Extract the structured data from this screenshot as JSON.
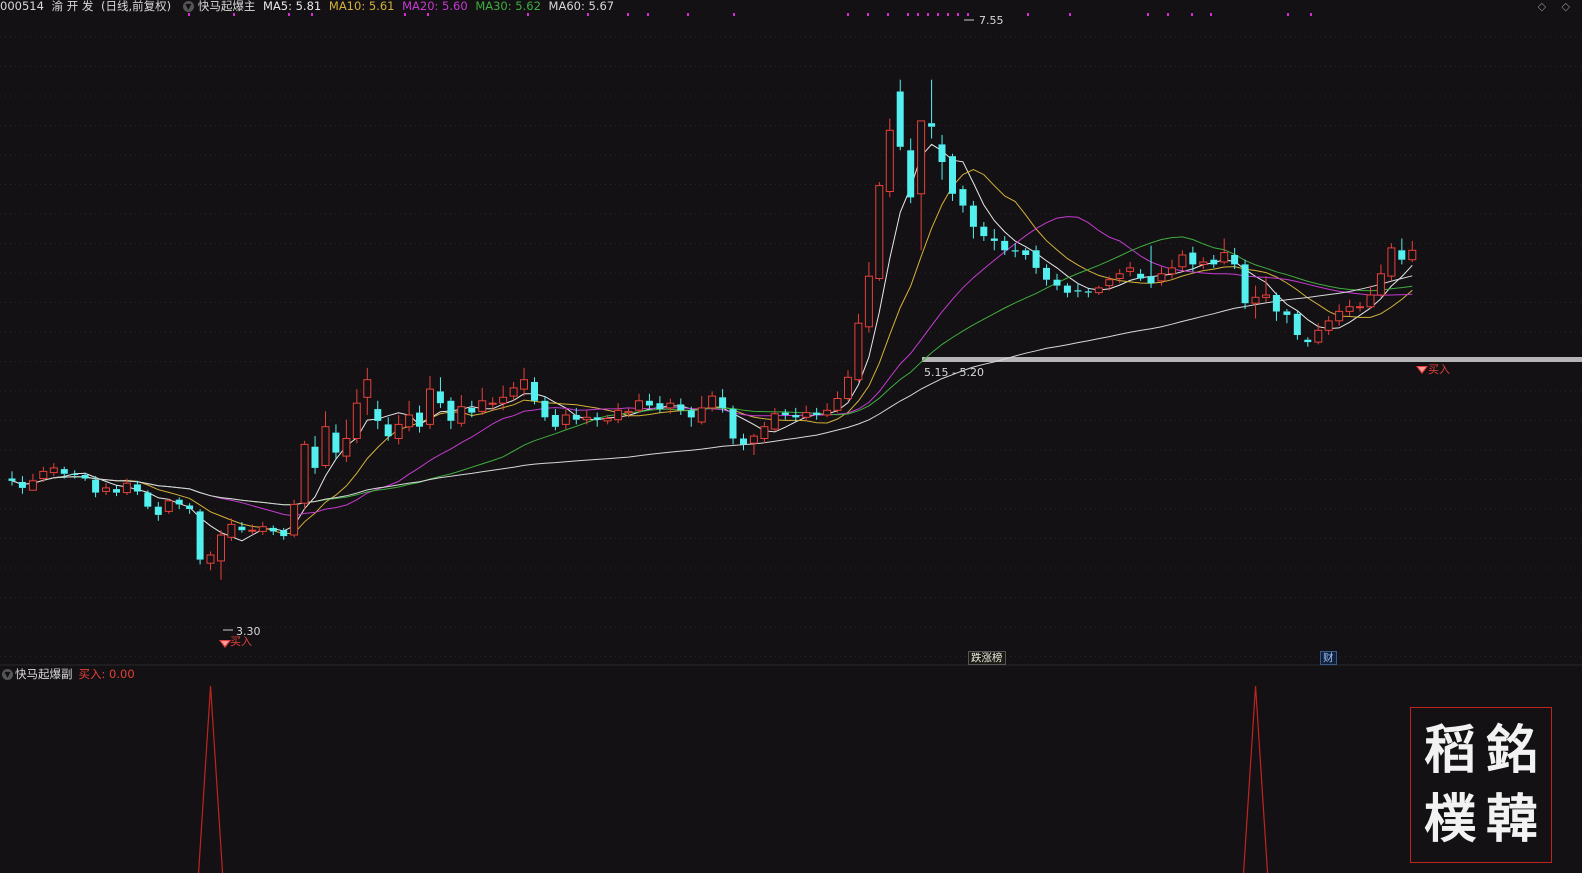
{
  "header": {
    "stock_code": "000514",
    "stock_name": "渝 开 发",
    "chart_mode": "(日线,前复权)",
    "indicator_name": "快马起爆主",
    "ma": [
      {
        "label": "MA5: 5.81",
        "color": "#e8e8e8"
      },
      {
        "label": "MA10: 5.61",
        "color": "#d4b23a"
      },
      {
        "label": "MA20: 5.60",
        "color": "#c63bd1"
      },
      {
        "label": "MA30: 5.62",
        "color": "#3fae3f"
      },
      {
        "label": "MA60: 5.67",
        "color": "#d8d8d8"
      }
    ]
  },
  "top_right": "◇ ◇",
  "annotations": {
    "high_label": "7.55",
    "low_label": "3.30",
    "range_label": "5.15 - 5.20",
    "buy_label": "买入",
    "tag_rank": "跌涨榜",
    "tag_fin": "财"
  },
  "sub": {
    "indicator_name": "快马起爆副",
    "buy_readout": "买入: 0.00"
  },
  "seal_chars": [
    "銘",
    "稻",
    "韓",
    "樸"
  ],
  "colors": {
    "up": "#e6403a",
    "down": "#54f0f0",
    "ma5": "#e8e8e8",
    "ma10": "#d4b23a",
    "ma20": "#c63bd1",
    "ma30": "#3fae3f",
    "ma60": "#d8d8d8",
    "support": "#b5b5b5",
    "signal": "#c0241f",
    "dots": "#d62bd6"
  },
  "chart_data": {
    "type": "candlestick",
    "price_axis": [
      2.6,
      8.1
    ],
    "high": 7.55,
    "low": 3.3,
    "support_zone": [
      5.15,
      5.2
    ],
    "buy_signals_at_candle": [
      19,
      119
    ],
    "candles": [
      [
        4.16,
        4.14,
        4.22,
        4.1
      ],
      [
        4.13,
        4.08,
        4.18,
        4.03
      ],
      [
        4.06,
        4.14,
        4.2,
        4.06
      ],
      [
        4.16,
        4.22,
        4.26,
        4.13
      ],
      [
        4.21,
        4.25,
        4.29,
        4.18
      ],
      [
        4.24,
        4.2,
        4.26,
        4.16
      ],
      [
        4.2,
        4.19,
        4.23,
        4.16
      ],
      [
        4.19,
        4.16,
        4.21,
        4.14
      ],
      [
        4.15,
        4.04,
        4.18,
        4.0
      ],
      [
        4.05,
        4.08,
        4.12,
        4.02
      ],
      [
        4.07,
        4.04,
        4.1,
        4.01
      ],
      [
        4.04,
        4.12,
        4.16,
        4.02
      ],
      [
        4.11,
        4.05,
        4.14,
        4.02
      ],
      [
        4.04,
        3.92,
        4.06,
        3.9
      ],
      [
        3.92,
        3.85,
        3.96,
        3.8
      ],
      [
        3.88,
        3.97,
        3.99,
        3.86
      ],
      [
        3.98,
        3.94,
        4.0,
        3.9
      ],
      [
        3.93,
        3.9,
        3.95,
        3.86
      ],
      [
        3.88,
        3.47,
        3.9,
        3.43
      ],
      [
        3.44,
        3.51,
        3.54,
        3.38
      ],
      [
        3.46,
        3.68,
        3.72,
        3.3
      ],
      [
        3.66,
        3.77,
        3.82,
        3.63
      ],
      [
        3.75,
        3.72,
        3.79,
        3.7
      ],
      [
        3.72,
        3.72,
        3.77,
        3.68
      ],
      [
        3.71,
        3.75,
        3.79,
        3.68
      ],
      [
        3.74,
        3.71,
        3.76,
        3.68
      ],
      [
        3.72,
        3.67,
        3.74,
        3.64
      ],
      [
        3.68,
        3.94,
        3.98,
        3.66
      ],
      [
        3.95,
        4.45,
        4.48,
        3.9
      ],
      [
        4.43,
        4.25,
        4.52,
        4.2
      ],
      [
        4.27,
        4.6,
        4.73,
        4.25
      ],
      [
        4.55,
        4.38,
        4.62,
        4.33
      ],
      [
        4.35,
        4.5,
        4.66,
        4.3
      ],
      [
        4.5,
        4.8,
        4.92,
        4.46
      ],
      [
        4.85,
        5.0,
        5.1,
        4.7
      ],
      [
        4.75,
        4.65,
        4.82,
        4.58
      ],
      [
        4.62,
        4.52,
        4.68,
        4.48
      ],
      [
        4.5,
        4.62,
        4.7,
        4.45
      ],
      [
        4.6,
        4.7,
        4.82,
        4.56
      ],
      [
        4.72,
        4.6,
        4.78,
        4.55
      ],
      [
        4.62,
        4.92,
        5.03,
        4.58
      ],
      [
        4.9,
        4.8,
        5.02,
        4.76
      ],
      [
        4.82,
        4.65,
        4.85,
        4.58
      ],
      [
        4.63,
        4.77,
        4.87,
        4.6
      ],
      [
        4.76,
        4.72,
        4.82,
        4.68
      ],
      [
        4.73,
        4.82,
        4.93,
        4.7
      ],
      [
        4.8,
        4.8,
        4.85,
        4.74
      ],
      [
        4.8,
        4.85,
        4.95,
        4.74
      ],
      [
        4.86,
        4.93,
        4.98,
        4.82
      ],
      [
        4.92,
        5.0,
        5.1,
        4.86
      ],
      [
        4.98,
        4.82,
        5.02,
        4.79
      ],
      [
        4.82,
        4.68,
        4.86,
        4.65
      ],
      [
        4.7,
        4.6,
        4.75,
        4.57
      ],
      [
        4.62,
        4.7,
        4.75,
        4.58
      ],
      [
        4.7,
        4.66,
        4.76,
        4.62
      ],
      [
        4.66,
        4.68,
        4.74,
        4.62
      ],
      [
        4.68,
        4.66,
        4.72,
        4.6
      ],
      [
        4.65,
        4.67,
        4.7,
        4.62
      ],
      [
        4.66,
        4.74,
        4.8,
        4.63
      ],
      [
        4.72,
        4.73,
        4.76,
        4.68
      ],
      [
        4.74,
        4.82,
        4.88,
        4.72
      ],
      [
        4.82,
        4.78,
        4.88,
        4.75
      ],
      [
        4.8,
        4.75,
        4.86,
        4.72
      ],
      [
        4.76,
        4.8,
        4.84,
        4.71
      ],
      [
        4.79,
        4.74,
        4.84,
        4.7
      ],
      [
        4.74,
        4.68,
        4.77,
        4.6
      ],
      [
        4.64,
        4.76,
        4.86,
        4.62
      ],
      [
        4.76,
        4.86,
        4.9,
        4.73
      ],
      [
        4.85,
        4.76,
        4.92,
        4.72
      ],
      [
        4.75,
        4.5,
        4.78,
        4.45
      ],
      [
        4.5,
        4.45,
        4.54,
        4.4
      ],
      [
        4.46,
        4.52,
        4.54,
        4.36
      ],
      [
        4.5,
        4.6,
        4.64,
        4.46
      ],
      [
        4.58,
        4.71,
        4.76,
        4.56
      ],
      [
        4.72,
        4.7,
        4.75,
        4.66
      ],
      [
        4.7,
        4.68,
        4.76,
        4.64
      ],
      [
        4.68,
        4.72,
        4.78,
        4.66
      ],
      [
        4.72,
        4.7,
        4.76,
        4.66
      ],
      [
        4.7,
        4.74,
        4.8,
        4.68
      ],
      [
        4.74,
        4.84,
        4.9,
        4.72
      ],
      [
        4.84,
        5.02,
        5.08,
        4.82
      ],
      [
        5.0,
        5.48,
        5.56,
        4.98
      ],
      [
        5.45,
        5.88,
        6.0,
        5.4
      ],
      [
        5.86,
        6.65,
        6.68,
        5.84
      ],
      [
        6.6,
        7.12,
        7.22,
        6.55
      ],
      [
        7.45,
        6.98,
        7.55,
        6.95
      ],
      [
        6.95,
        6.55,
        7.05,
        6.5
      ],
      [
        6.58,
        7.2,
        7.2,
        6.1
      ],
      [
        7.18,
        7.15,
        7.55,
        7.05
      ],
      [
        7.0,
        6.85,
        7.08,
        6.7
      ],
      [
        6.9,
        6.58,
        6.92,
        6.52
      ],
      [
        6.62,
        6.48,
        6.65,
        6.42
      ],
      [
        6.48,
        6.3,
        6.52,
        6.2
      ],
      [
        6.3,
        6.22,
        6.34,
        6.18
      ],
      [
        6.2,
        6.18,
        6.28,
        6.1
      ],
      [
        6.18,
        6.1,
        6.22,
        6.06
      ],
      [
        6.1,
        6.09,
        6.16,
        6.04
      ],
      [
        6.1,
        6.06,
        6.12,
        6.02
      ],
      [
        6.1,
        5.95,
        6.14,
        5.9
      ],
      [
        5.95,
        5.85,
        5.98,
        5.8
      ],
      [
        5.85,
        5.8,
        5.9,
        5.76
      ],
      [
        5.8,
        5.74,
        5.82,
        5.7
      ],
      [
        5.76,
        5.75,
        5.82,
        5.7
      ],
      [
        5.75,
        5.74,
        5.78,
        5.7
      ],
      [
        5.74,
        5.78,
        5.8,
        5.72
      ],
      [
        5.8,
        5.85,
        5.88,
        5.76
      ],
      [
        5.86,
        5.9,
        5.94,
        5.82
      ],
      [
        5.92,
        5.95,
        6.0,
        5.88
      ],
      [
        5.9,
        5.86,
        5.94,
        5.84
      ],
      [
        5.88,
        5.82,
        6.14,
        5.78
      ],
      [
        5.84,
        5.9,
        5.96,
        5.8
      ],
      [
        5.9,
        5.95,
        6.02,
        5.86
      ],
      [
        5.96,
        6.06,
        6.1,
        5.92
      ],
      [
        6.08,
        5.98,
        6.13,
        5.92
      ],
      [
        5.98,
        6.0,
        6.04,
        5.94
      ],
      [
        6.02,
        5.98,
        6.06,
        5.95
      ],
      [
        6.0,
        6.08,
        6.2,
        5.98
      ],
      [
        6.06,
        5.98,
        6.12,
        5.94
      ],
      [
        5.98,
        5.65,
        6.02,
        5.6
      ],
      [
        5.65,
        5.7,
        5.8,
        5.52
      ],
      [
        5.7,
        5.72,
        5.88,
        5.66
      ],
      [
        5.72,
        5.58,
        5.74,
        5.5
      ],
      [
        5.58,
        5.55,
        5.6,
        5.48
      ],
      [
        5.56,
        5.38,
        5.58,
        5.34
      ],
      [
        5.34,
        5.32,
        5.36,
        5.28
      ],
      [
        5.32,
        5.42,
        5.48,
        5.3
      ],
      [
        5.42,
        5.5,
        5.54,
        5.38
      ],
      [
        5.5,
        5.58,
        5.64,
        5.46
      ],
      [
        5.58,
        5.62,
        5.68,
        5.54
      ],
      [
        5.62,
        5.62,
        5.66,
        5.58
      ],
      [
        5.62,
        5.72,
        5.8,
        5.6
      ],
      [
        5.72,
        5.9,
        5.98,
        5.7
      ],
      [
        5.88,
        6.12,
        6.16,
        5.84
      ],
      [
        6.1,
        6.02,
        6.2,
        5.98
      ],
      [
        6.02,
        6.1,
        6.18,
        6.0
      ]
    ]
  }
}
